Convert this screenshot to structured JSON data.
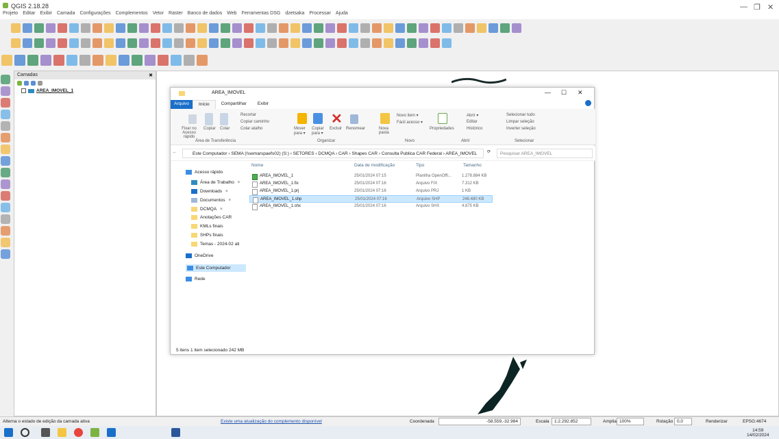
{
  "window": {
    "title": "QGIS 2.18.28"
  },
  "menubar": [
    "Projeto",
    "Editar",
    "Exibir",
    "Camada",
    "Configurações",
    "Complementos",
    "Vetor",
    "Raster",
    "Banco de dados",
    "Web",
    "Ferramentas DSG",
    "dzetsaka",
    "Processar",
    "Ajuda"
  ],
  "layers_panel": {
    "title": "Camadas",
    "close_label": "✖",
    "layer": "AREA_IMOVEL_1"
  },
  "explorer": {
    "title": "AREA_IMOVEL",
    "tabs": [
      "Arquivo",
      "Início",
      "Compartilhar",
      "Exibir"
    ],
    "ribbon": {
      "clipboard": {
        "pin": "Fixar no Acesso rápido",
        "copy": "Copiar",
        "paste": "Colar",
        "cut": "Recortar",
        "copy_path": "Copiar caminho",
        "paste_shortcut": "Colar atalho",
        "group": "Área de Transferência"
      },
      "organize": {
        "move": "Mover para ▾",
        "copy_to": "Copiar para ▾",
        "delete": "Excluir",
        "rename": "Renomear",
        "group": "Organizar"
      },
      "new": {
        "new_folder": "Nova pasta",
        "new_item": "Novo item ▾",
        "easy_access": "Fácil acesso ▾",
        "group": "Novo"
      },
      "open": {
        "properties": "Propriedades",
        "open": "Abrir ▾",
        "edit": "Editar",
        "history": "Histórico",
        "group": "Abrir"
      },
      "select": {
        "select_all": "Selecionar tudo",
        "clear": "Limpar seleção",
        "invert": "Inverter seleção",
        "group": "Selecionar"
      }
    },
    "address": "Este Computador › SEMA (\\\\semarspaefs02) (S:) › SETORES › DCMQA › CAR › Shapes CAR › Consulta Publica CAR Federal › AREA_IMOVEL",
    "search_placeholder": "Pesquisar AREA_IMOVEL",
    "nav": [
      {
        "label": "Acesso rápido",
        "pin": ""
      },
      {
        "label": "Área de Trabalho",
        "pin": "✶"
      },
      {
        "label": "Downloads",
        "pin": "✶"
      },
      {
        "label": "Documentos",
        "pin": "✶"
      },
      {
        "label": "DCMQA",
        "pin": "✶"
      },
      {
        "label": "Anotações CAR",
        "pin": ""
      },
      {
        "label": "KMLs finais",
        "pin": ""
      },
      {
        "label": "SHPs finais",
        "pin": ""
      },
      {
        "label": "Temas - 2024-02 ati",
        "pin": ""
      },
      {
        "label": "OneDrive",
        "pin": ""
      },
      {
        "label": "Este Computador",
        "pin": ""
      },
      {
        "label": "Rede",
        "pin": ""
      }
    ],
    "columns": [
      "Nome",
      "Data de modificação",
      "Tipo",
      "Tamanho"
    ],
    "files": [
      {
        "name": "AREA_IMOVEL_1",
        "date": "25/01/2024 07:15",
        "type": "Planilha OpenOffi...",
        "size": "1.278.884 KB"
      },
      {
        "name": "AREA_IMOVEL_1.fix",
        "date": "25/01/2024 07:16",
        "type": "Arquivo FIX",
        "size": "7.312 KB"
      },
      {
        "name": "AREA_IMOVEL_1.prj",
        "date": "25/01/2024 07:16",
        "type": "Arquivo PRJ",
        "size": "1 KB"
      },
      {
        "name": "AREA_IMOVEL_1.shp",
        "date": "25/01/2024 07:16",
        "type": "Arquivo SHP",
        "size": "248.480 KB"
      },
      {
        "name": "AREA_IMOVEL_1.shx",
        "date": "25/01/2024 07:16",
        "type": "Arquivo SHX",
        "size": "4.875 KB"
      }
    ],
    "status": "5 itens   1 item selecionado 242 MB"
  },
  "statusbar": {
    "left": "Alterna o estado de edição da camada ativa",
    "update": "Existe uma atualização do complemento disponível",
    "coord_label": "Coordenada",
    "coord": "-58.559,-32.984",
    "scale_label": "Escala",
    "scale": "1:2.292.852",
    "zoom_label": "Ampliar",
    "zoom": "100%",
    "rot_label": "Rotação",
    "rot": "0,0",
    "render": "Renderizar",
    "epsg": "EPSG:4674"
  },
  "taskbar": {
    "time": "14:59",
    "date": "14/02/2024"
  }
}
